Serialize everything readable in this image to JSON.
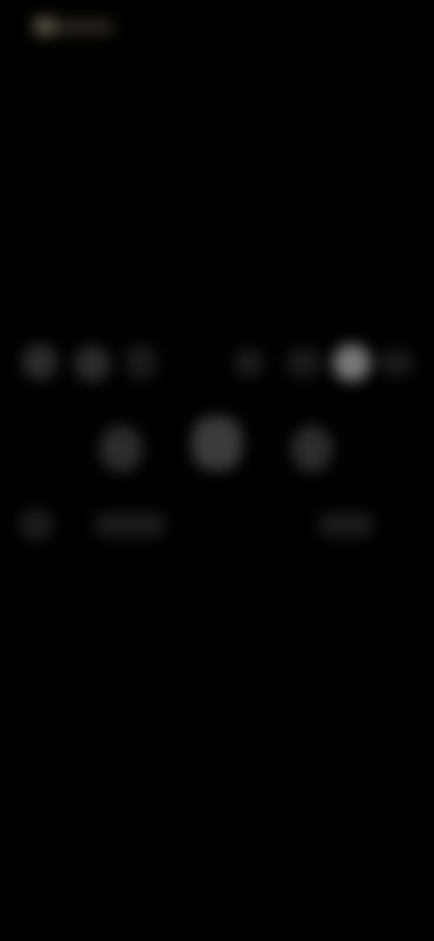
{
  "screen": {
    "background": "#000000",
    "state": "obscured-dark-overlay"
  },
  "status_bar": {
    "indicator_color": "#6e6a58"
  },
  "controls_row_top": [
    {
      "name": "control-1",
      "level": "dim"
    },
    {
      "name": "control-2",
      "level": "dim"
    },
    {
      "name": "control-3",
      "level": "faint"
    },
    {
      "name": "control-4",
      "level": "faint"
    },
    {
      "name": "control-5",
      "level": "faint"
    },
    {
      "name": "control-6",
      "level": "bright"
    },
    {
      "name": "control-7",
      "level": "faint"
    }
  ],
  "controls_row_middle": [
    {
      "name": "previous",
      "level": "dim"
    },
    {
      "name": "play-pause",
      "level": "mid"
    },
    {
      "name": "next",
      "level": "dim"
    }
  ],
  "controls_row_bottom": [
    {
      "name": "bottom-left",
      "level": "faint"
    },
    {
      "name": "bottom-center",
      "level": "faint"
    },
    {
      "name": "bottom-right",
      "level": "faint"
    }
  ]
}
